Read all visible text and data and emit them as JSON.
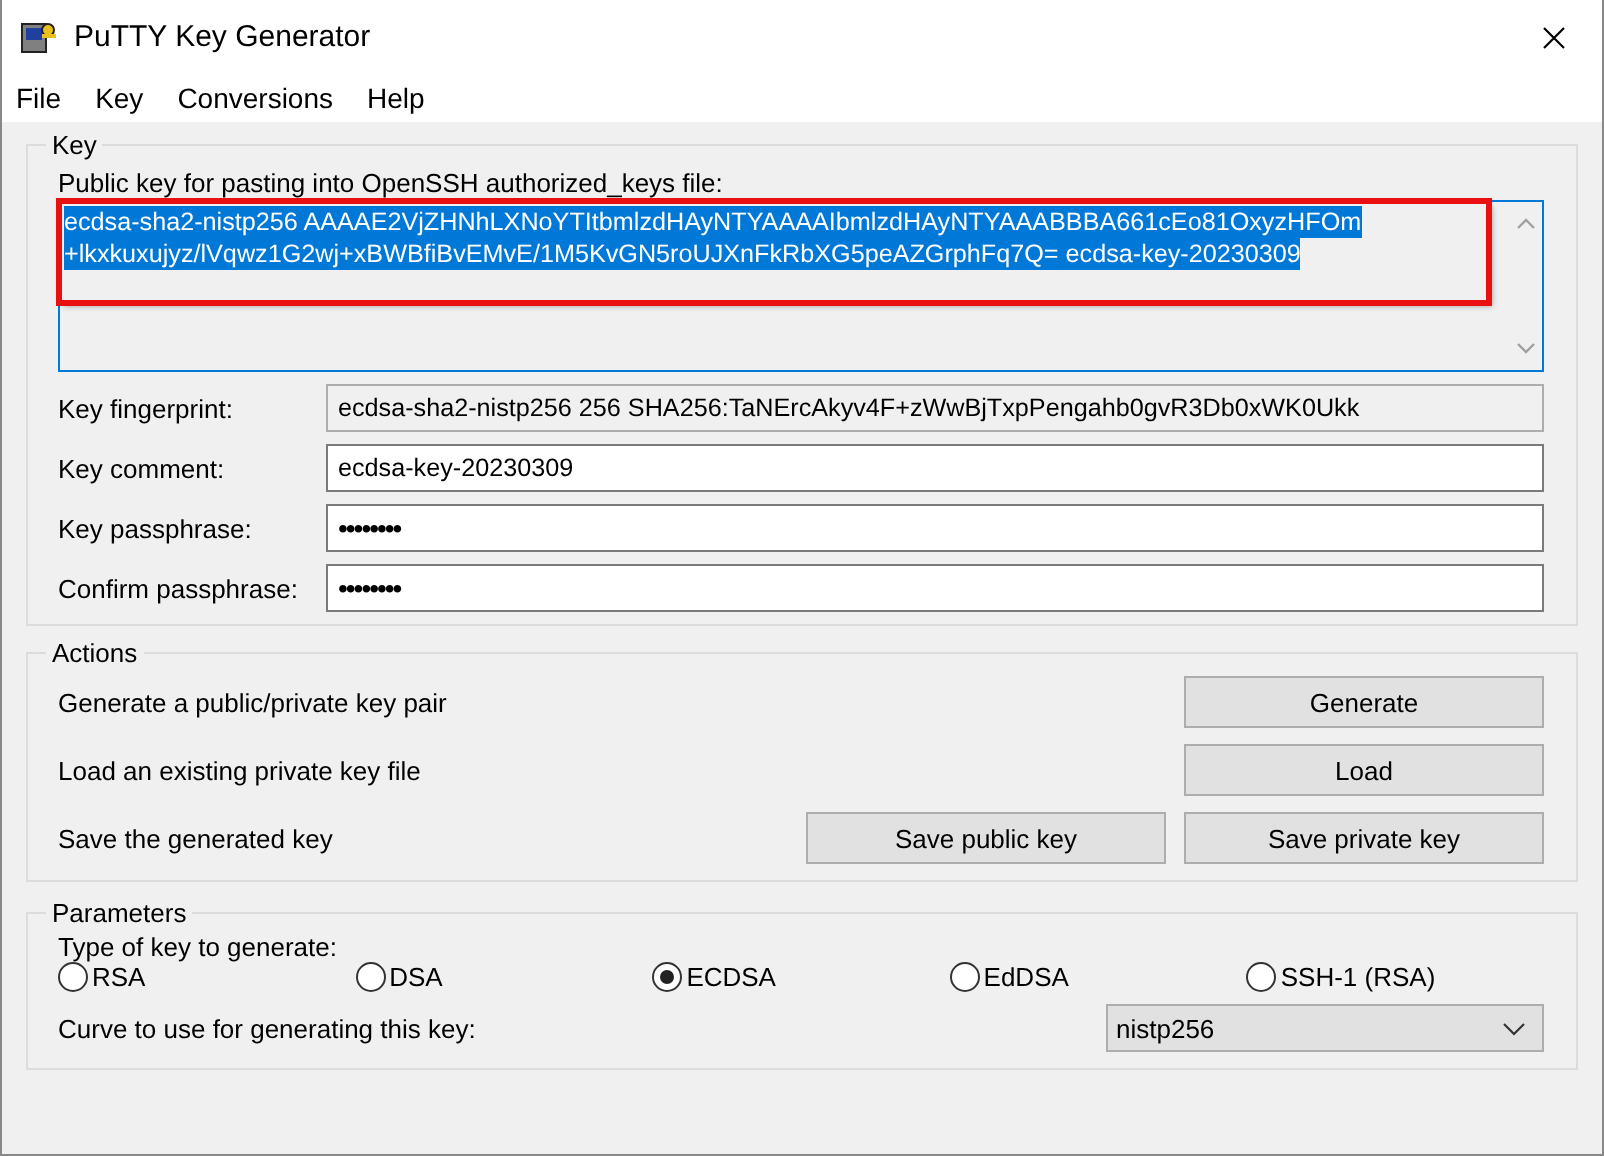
{
  "window": {
    "title": "PuTTY Key Generator"
  },
  "menu": [
    "File",
    "Key",
    "Conversions",
    "Help"
  ],
  "key_group": {
    "title": "Key",
    "public_key_label": "Public key for pasting into OpenSSH authorized_keys file:",
    "public_key": {
      "lines": [
        "ecdsa-sha2-nistp256 AAAAE2VjZHNhLXNoYTItbmlzdHAyNTYAAAAIbmlzdHAyNTYAAABBBA661cEo81OxyzHFOm",
        "+lkxkuxujyz/lVqwz1G2wj+xBWBfiBvEMvE/1M5KvGN5roUJXnFkRbXG5peAZGrphFq7Q= ecdsa-key-20230309"
      ],
      "selected": true,
      "highlighted": true
    },
    "fields": [
      {
        "label": "Key fingerprint:",
        "value": "ecdsa-sha2-nistp256 256 SHA256:TaNErcAkyv4F+zWwBjTxpPengahb0gvR3Db0xWK0Ukk",
        "kind": "readonly"
      },
      {
        "label": "Key comment:",
        "value": "ecdsa-key-20230309",
        "kind": "text"
      },
      {
        "label": "Key passphrase:",
        "value": "••••••••",
        "kind": "password"
      },
      {
        "label": "Confirm passphrase:",
        "value": "••••••••",
        "kind": "password"
      }
    ]
  },
  "actions_group": {
    "title": "Actions",
    "rows": [
      {
        "label": "Generate a public/private key pair",
        "buttons": [
          "Generate"
        ]
      },
      {
        "label": "Load an existing private key file",
        "buttons": [
          "Load"
        ]
      },
      {
        "label": "Save the generated key",
        "buttons": [
          "Save public key",
          "Save private key"
        ]
      }
    ]
  },
  "parameters_group": {
    "title": "Parameters",
    "type_label": "Type of key to generate:",
    "key_types": [
      {
        "label": "RSA",
        "selected": false
      },
      {
        "label": "DSA",
        "selected": false
      },
      {
        "label": "ECDSA",
        "selected": true
      },
      {
        "label": "EdDSA",
        "selected": false
      },
      {
        "label": "SSH-1 (RSA)",
        "selected": false
      }
    ],
    "curve_label": "Curve to use for generating this key:",
    "curve": "nistp256"
  }
}
